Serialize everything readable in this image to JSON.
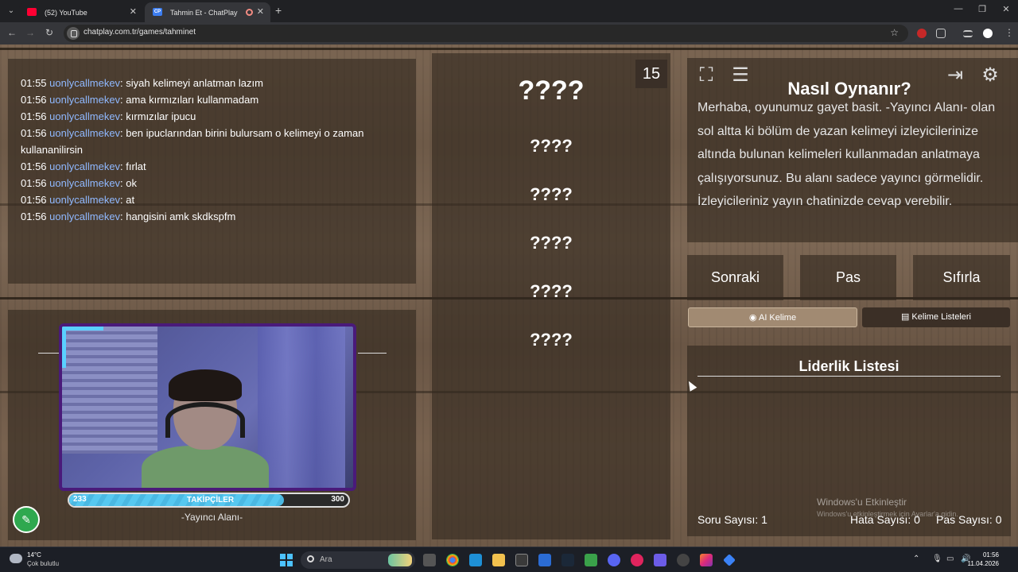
{
  "browser": {
    "tabs": [
      {
        "title": "(52) YouTube"
      },
      {
        "title": "Tahmin Et - ChatPlay"
      }
    ],
    "url": "chatplay.com.tr/games/tahminet",
    "tab2_favicon": "CP"
  },
  "chat": {
    "messages": [
      {
        "time": "01:55",
        "user": "uonlycallmekev",
        "text": ": siyah kelimeyi anlatman lazım"
      },
      {
        "time": "01:56",
        "user": "uonlycallmekev",
        "text": ": ama kırmızıları kullanmadam"
      },
      {
        "time": "01:56",
        "user": "uonlycallmekev",
        "text": ": kırmızılar ipucu"
      },
      {
        "time": "01:56",
        "user": "uonlycallmekev",
        "text": ": ben ipuclarından birini bulursam o kelimeyi o zaman kullananilirsin"
      },
      {
        "time": "01:56",
        "user": "uonlycallmekev",
        "text": ": fırlat"
      },
      {
        "time": "01:56",
        "user": "uonlycallmekev",
        "text": ": ok"
      },
      {
        "time": "01:56",
        "user": "uonlycallmekev",
        "text": ": at"
      },
      {
        "time": "01:56",
        "user": "uonlycallmekev",
        "text": ": hangisini amk skdkspfm"
      }
    ]
  },
  "streamer": {
    "followers_min": "233",
    "followers_max": "300",
    "followers_label": "TAKİPÇİLER",
    "followers_progress": 0.77,
    "area_label": "-Yayıncı Alanı-"
  },
  "game": {
    "timer": "15",
    "main_word": "????",
    "hints": [
      "????",
      "????",
      "????",
      "????",
      "????"
    ]
  },
  "info": {
    "title": "Nasıl Oynanır?",
    "text": "Merhaba, oyunumuz gayet basit. -Yayıncı Alanı- olan sol altta ki bölüm de yazan kelimeyi izleyicilerinize altında bulunan kelimeleri kullanmadan anlatmaya çalışıyorsunuz. Bu alanı sadece yayıncı görmelidir. İzleyicileriniz yayın chatinizde cevap verebilir."
  },
  "controls": {
    "next": "Sonraki",
    "pass": "Pas",
    "reset": "Sıfırla",
    "ai_word": "AI Kelime",
    "word_lists": "Kelime Listeleri"
  },
  "leaderboard": {
    "title": "Liderlik Listesi",
    "question_count": "Soru Sayısı: 1",
    "error_count": "Hata Sayısı: 0",
    "pass_count": "Pas Sayısı: 0"
  },
  "watermark": {
    "line1": "Windows'u Etkinleştir",
    "line2": "Windows'u etkinleştirmek için Ayarlar'a gidin."
  },
  "taskbar": {
    "temperature": "14°C",
    "weather": "Çok bulutlu",
    "search_placeholder": "Ara",
    "time": "01:56",
    "date": "11.04.2026"
  }
}
